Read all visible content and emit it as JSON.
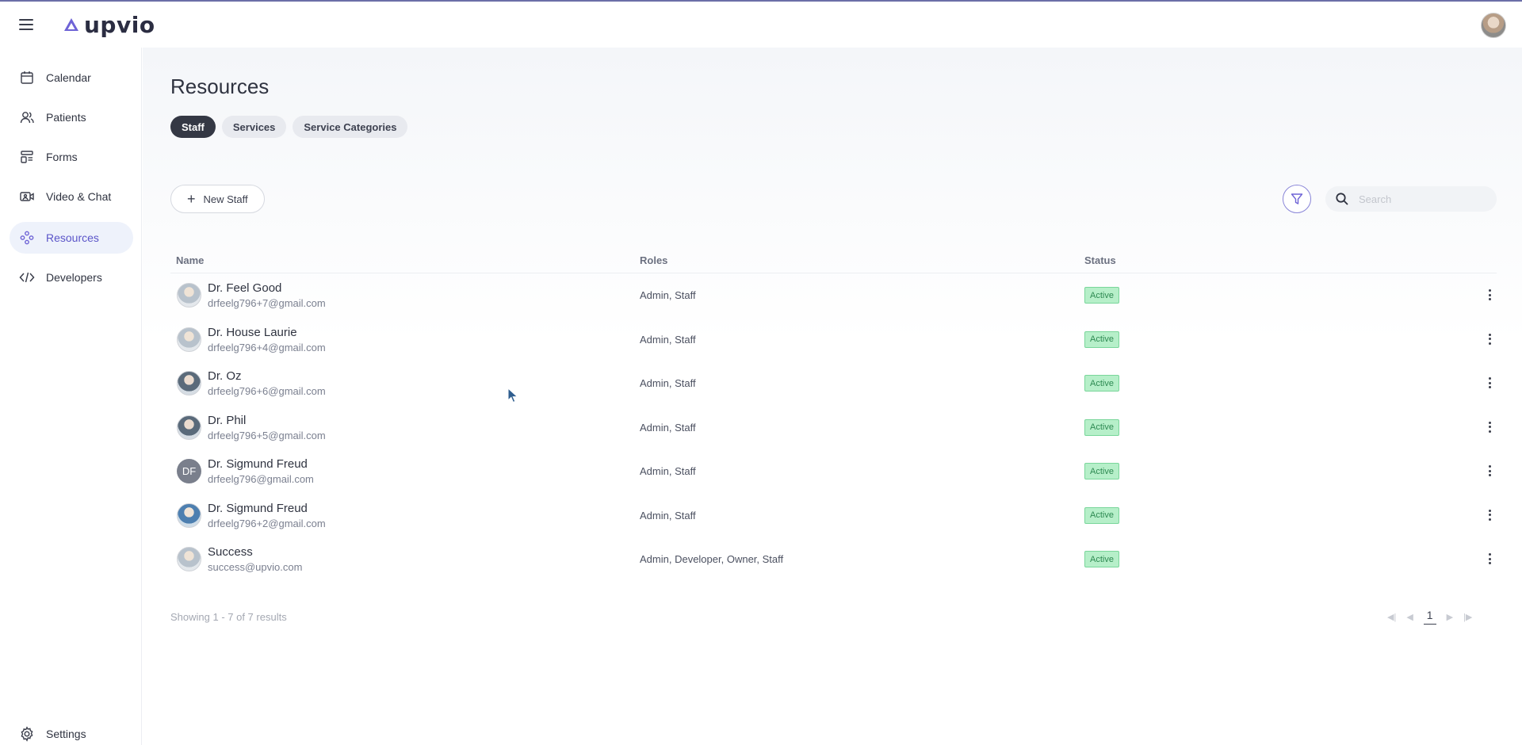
{
  "app": {
    "brand": "upvio"
  },
  "sidebar": {
    "items": [
      {
        "label": "Calendar",
        "icon": "calendar-icon"
      },
      {
        "label": "Patients",
        "icon": "users-icon"
      },
      {
        "label": "Forms",
        "icon": "forms-icon"
      },
      {
        "label": "Video & Chat",
        "icon": "video-icon"
      },
      {
        "label": "Resources",
        "icon": "resources-icon",
        "active": true
      },
      {
        "label": "Developers",
        "icon": "code-icon"
      }
    ],
    "settings": {
      "label": "Settings",
      "icon": "gear-icon"
    }
  },
  "page": {
    "title": "Resources"
  },
  "tabs": [
    {
      "label": "Staff",
      "active": true
    },
    {
      "label": "Services",
      "active": false
    },
    {
      "label": "Service Categories",
      "active": false
    }
  ],
  "toolbar": {
    "new_label": "New Staff",
    "search_placeholder": "Search"
  },
  "table": {
    "columns": {
      "name": "Name",
      "roles": "Roles",
      "status": "Status"
    },
    "rows": [
      {
        "name": "Dr. Feel Good",
        "email": "drfeelg796+7@gmail.com",
        "roles": "Admin, Staff",
        "status": "Active"
      },
      {
        "name": "Dr. House Laurie",
        "email": "drfeelg796+4@gmail.com",
        "roles": "Admin, Staff",
        "status": "Active"
      },
      {
        "name": "Dr. Oz",
        "email": "drfeelg796+6@gmail.com",
        "roles": "Admin, Staff",
        "status": "Active"
      },
      {
        "name": "Dr. Phil",
        "email": "drfeelg796+5@gmail.com",
        "roles": "Admin, Staff",
        "status": "Active"
      },
      {
        "name": "Dr. Sigmund Freud",
        "email": "drfeelg796@gmail.com",
        "roles": "Admin, Staff",
        "status": "Active",
        "initials": "DF"
      },
      {
        "name": "Dr. Sigmund Freud",
        "email": "drfeelg796+2@gmail.com",
        "roles": "Admin, Staff",
        "status": "Active"
      },
      {
        "name": "Success",
        "email": "success@upvio.com",
        "roles": "Admin, Developer, Owner, Staff",
        "status": "Active"
      }
    ]
  },
  "footer": {
    "results": "Showing 1 - 7 of 7 results",
    "current_page": "1"
  },
  "colors": {
    "accent": "#5b55c9",
    "active_tab": "#343844",
    "status_bg": "#b6efc9",
    "status_text": "#2e8a52"
  }
}
